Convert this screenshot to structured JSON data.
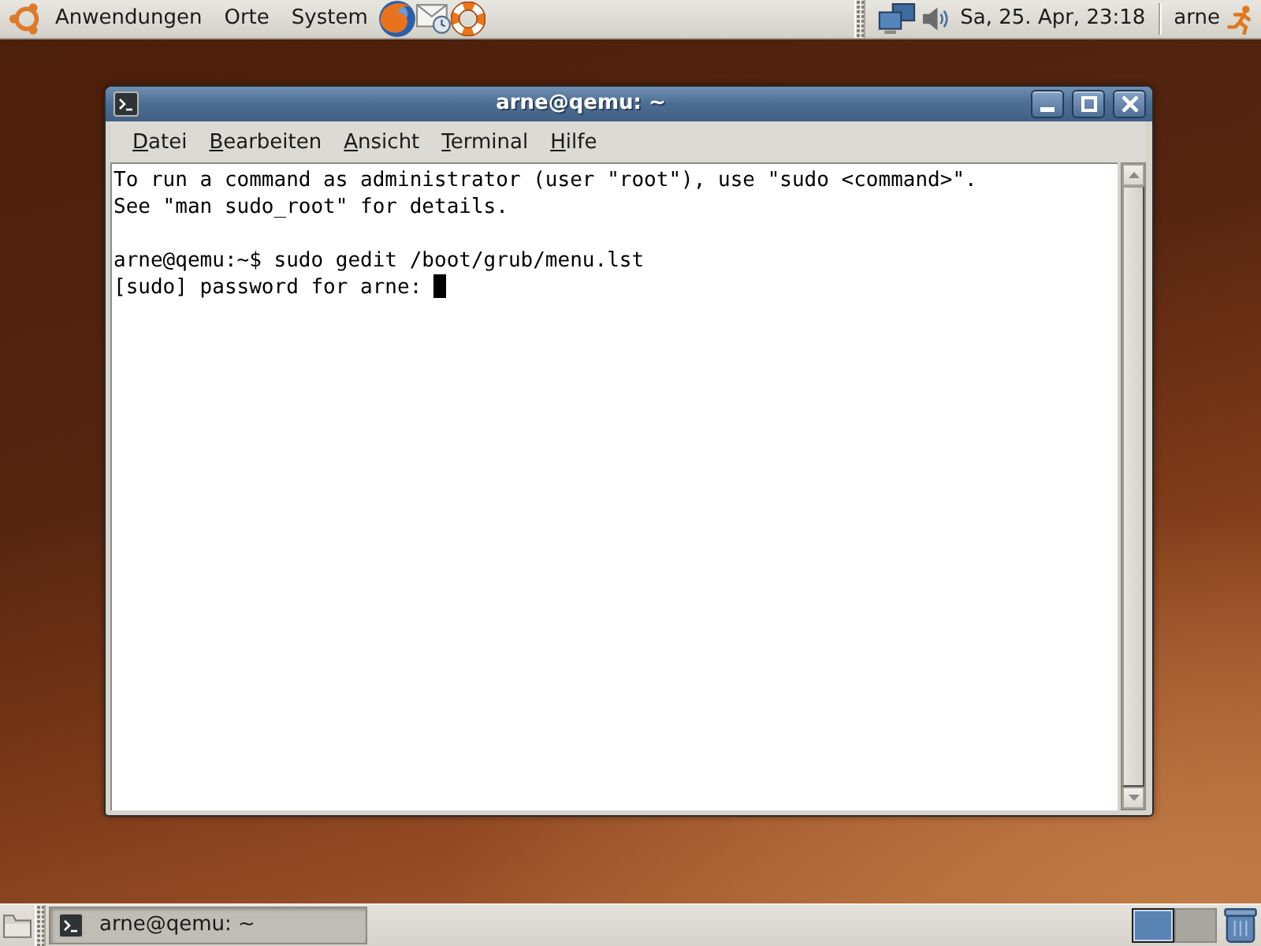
{
  "top_panel": {
    "menus": [
      "Anwendungen",
      "Orte",
      "System"
    ],
    "clock": "Sa, 25. Apr, 23:18",
    "user": "arne"
  },
  "window": {
    "title": "arne@qemu: ~",
    "menu": [
      "Datei",
      "Bearbeiten",
      "Ansicht",
      "Terminal",
      "Hilfe"
    ],
    "terminal": {
      "blocks": [
        [
          "To run a command as administrator (user \"root\"), use \"sudo <command>\".",
          "See \"man sudo_root\" for details."
        ],
        [
          "arne@qemu:~$ sudo gedit /boot/grub/menu.lst",
          "[sudo] password for arne:"
        ]
      ],
      "cursor": true
    }
  },
  "bottom_panel": {
    "tasks": [
      {
        "label": "arne@qemu: ~",
        "selected": true
      }
    ],
    "workspaces": [
      {
        "selected": true
      },
      {
        "selected": false
      }
    ]
  }
}
